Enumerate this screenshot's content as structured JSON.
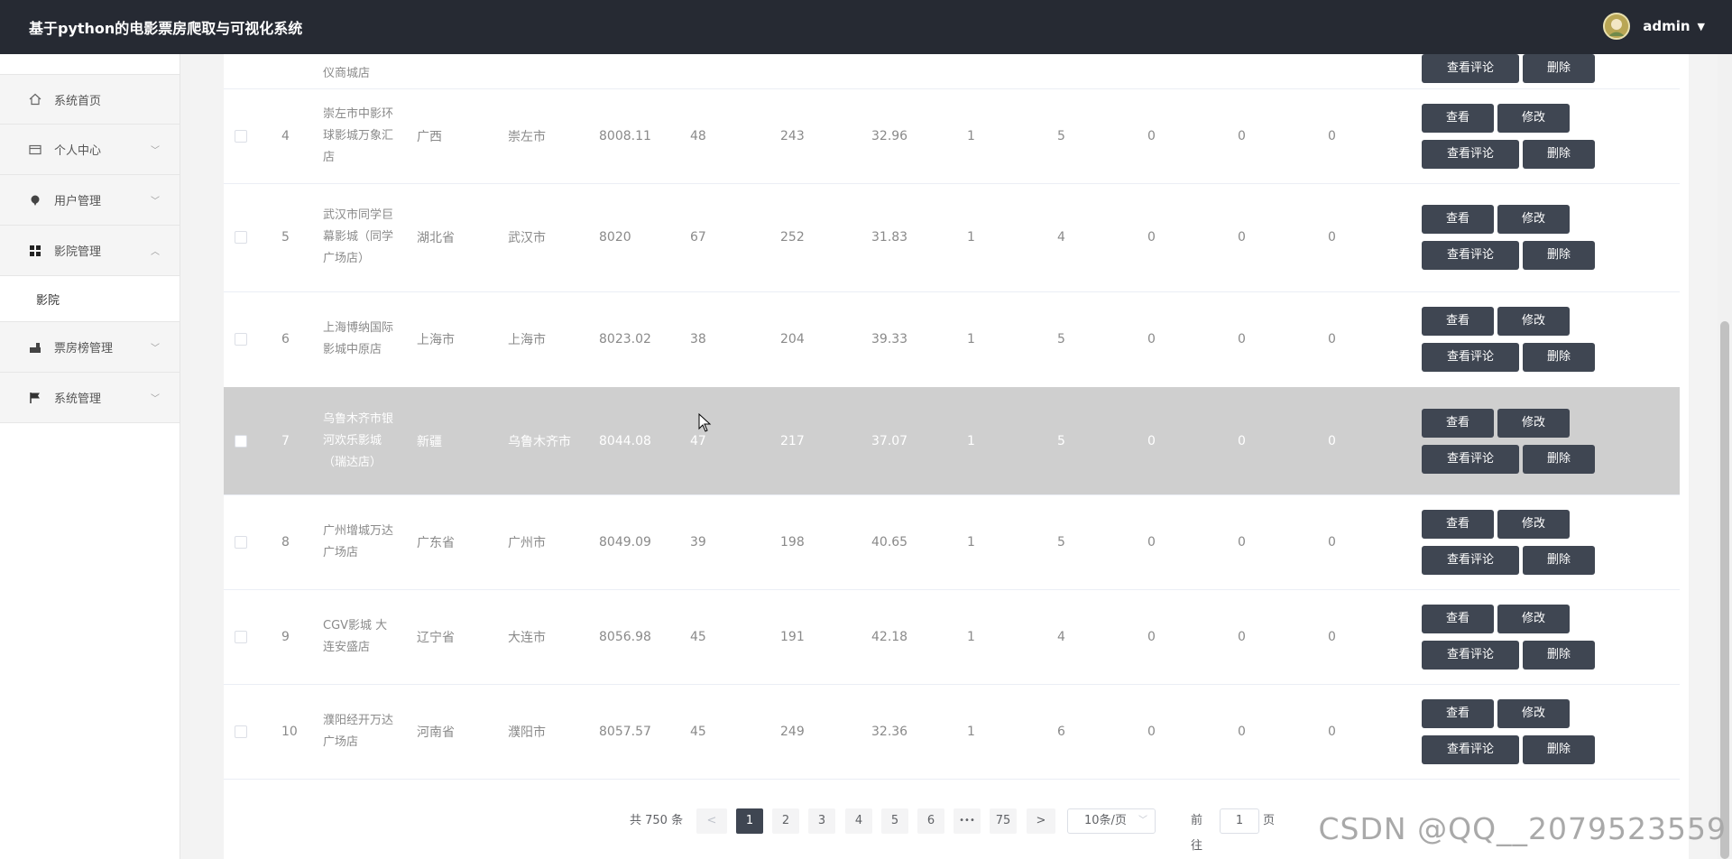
{
  "header": {
    "title": "基于python的电影票房爬取与可视化系统",
    "username": "admin"
  },
  "sidebar": {
    "items": [
      {
        "label": "系统首页",
        "icon": "home-icon"
      },
      {
        "label": "个人中心",
        "icon": "id-card-icon"
      },
      {
        "label": "用户管理",
        "icon": "pin-icon"
      },
      {
        "label": "影院管理",
        "icon": "grid-icon",
        "open": true,
        "children": [
          "影院"
        ]
      },
      {
        "label": "票房榜管理",
        "icon": "chart-icon"
      },
      {
        "label": "系统管理",
        "icon": "flag-icon"
      }
    ]
  },
  "table": {
    "partial_row": {
      "name_tail": "仪商城店"
    },
    "rows": [
      {
        "index": "4",
        "name": "崇左市中影环球影城万象汇店",
        "province": "广西",
        "city": "崇左市",
        "c1": "8008.11",
        "c2": "48",
        "c3": "243",
        "c4": "32.96",
        "c5": "1",
        "c6": "5",
        "c7": "0",
        "c8": "0",
        "c9": "0"
      },
      {
        "index": "5",
        "name": "武汉市同学巨幕影城（同学广场店）",
        "province": "湖北省",
        "city": "武汉市",
        "c1": "8020",
        "c2": "67",
        "c3": "252",
        "c4": "31.83",
        "c5": "1",
        "c6": "4",
        "c7": "0",
        "c8": "0",
        "c9": "0"
      },
      {
        "index": "6",
        "name": "上海博纳国际影城中原店",
        "province": "上海市",
        "city": "上海市",
        "c1": "8023.02",
        "c2": "38",
        "c3": "204",
        "c4": "39.33",
        "c5": "1",
        "c6": "5",
        "c7": "0",
        "c8": "0",
        "c9": "0"
      },
      {
        "index": "7",
        "name": "乌鲁木齐市银河欢乐影城（瑞达店）",
        "province": "新疆",
        "city": "乌鲁木齐市",
        "c1": "8044.08",
        "c2": "47",
        "c3": "217",
        "c4": "37.07",
        "c5": "1",
        "c6": "5",
        "c7": "0",
        "c8": "0",
        "c9": "0"
      },
      {
        "index": "8",
        "name": "广州增城万达广场店",
        "province": "广东省",
        "city": "广州市",
        "c1": "8049.09",
        "c2": "39",
        "c3": "198",
        "c4": "40.65",
        "c5": "1",
        "c6": "5",
        "c7": "0",
        "c8": "0",
        "c9": "0"
      },
      {
        "index": "9",
        "name": "CGV影城 大连安盛店",
        "province": "辽宁省",
        "city": "大连市",
        "c1": "8056.98",
        "c2": "45",
        "c3": "191",
        "c4": "42.18",
        "c5": "1",
        "c6": "4",
        "c7": "0",
        "c8": "0",
        "c9": "0"
      },
      {
        "index": "10",
        "name": "濮阳经开万达广场店",
        "province": "河南省",
        "city": "濮阳市",
        "c1": "8057.57",
        "c2": "45",
        "c3": "249",
        "c4": "32.36",
        "c5": "1",
        "c6": "6",
        "c7": "0",
        "c8": "0",
        "c9": "0"
      }
    ],
    "actions": {
      "view": "查看",
      "edit": "修改",
      "comments": "查看评论",
      "delete": "删除"
    }
  },
  "pagination": {
    "total": "共 750 条",
    "prev": "<",
    "pages": [
      "1",
      "2",
      "3",
      "4",
      "5",
      "6",
      "•••",
      "75"
    ],
    "current": "1",
    "next": ">",
    "page_size": "10条/页",
    "goto_label": "前往",
    "goto_value": "1",
    "goto_suffix": "页"
  },
  "watermark": "CSDN @QQ__2079523559"
}
